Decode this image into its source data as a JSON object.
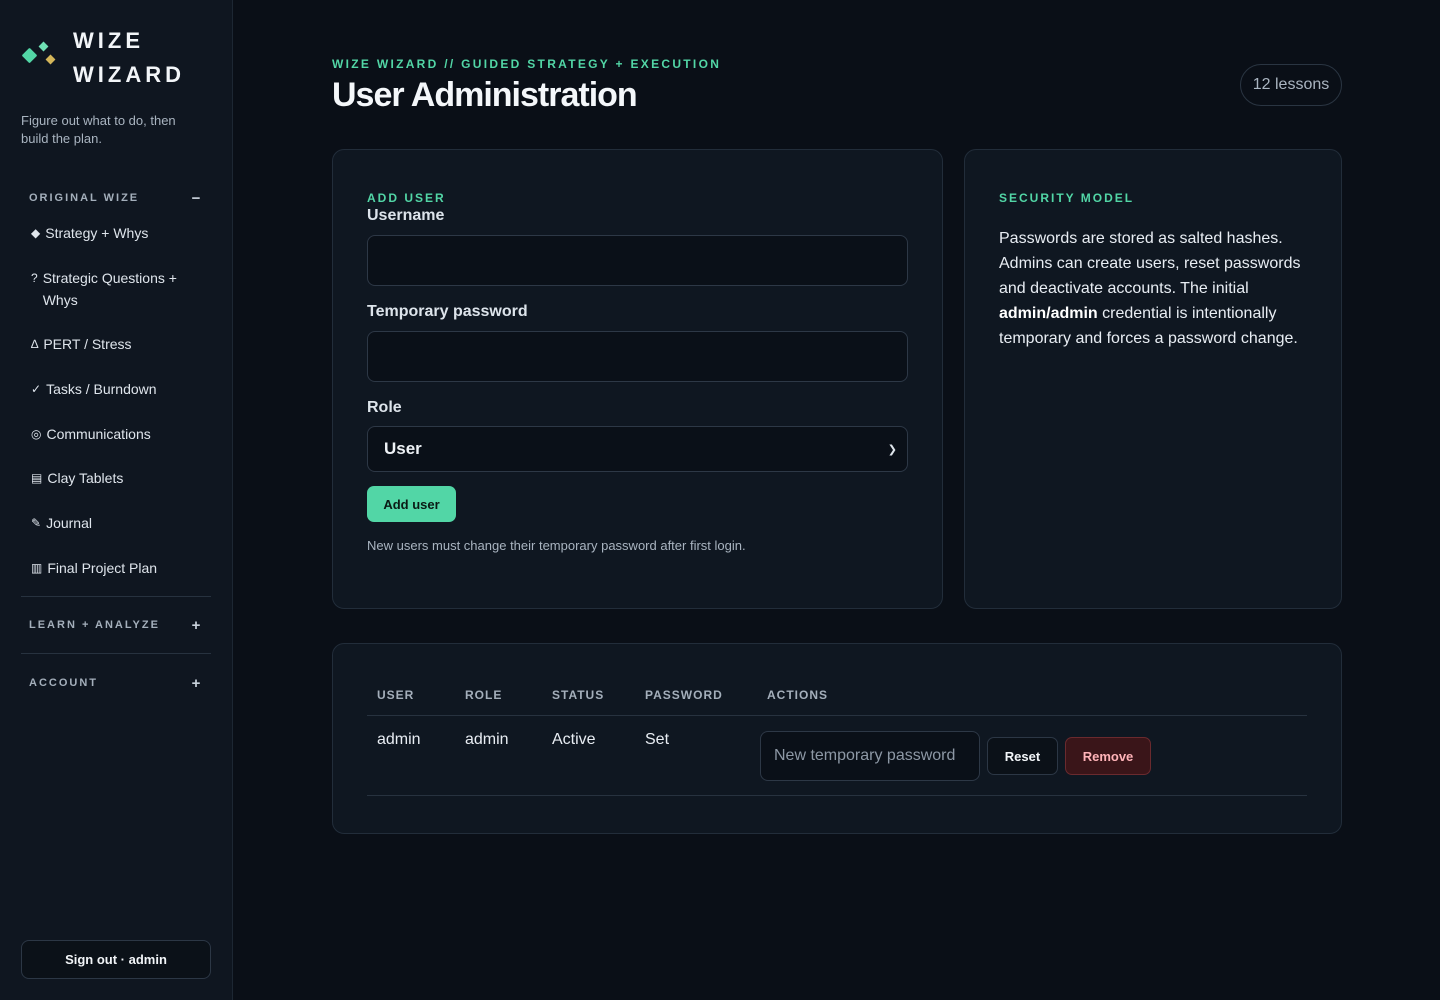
{
  "sidebar": {
    "brand_line1": "WIZE",
    "brand_line2": "WIZARD",
    "tagline": "Figure out what to do, then build the plan.",
    "sections": [
      {
        "label": "ORIGINAL WIZE",
        "toggle": "−",
        "items": [
          {
            "icon": "◆",
            "label": "Strategy + Whys"
          },
          {
            "icon": "?",
            "label": "Strategic Questions + Whys"
          },
          {
            "icon": "∆",
            "label": "PERT / Stress"
          },
          {
            "icon": "✓",
            "label": "Tasks / Burndown"
          },
          {
            "icon": "◎",
            "label": "Communications"
          },
          {
            "icon": "▤",
            "label": "Clay Tablets"
          },
          {
            "icon": "✎",
            "label": "Journal"
          },
          {
            "icon": "▥",
            "label": "Final Project Plan"
          }
        ]
      },
      {
        "label": "LEARN + ANALYZE",
        "toggle": "+"
      },
      {
        "label": "ACCOUNT",
        "toggle": "+"
      }
    ],
    "signout_label": "Sign out · admin"
  },
  "header": {
    "eyebrow": "WIZE WIZARD // GUIDED STRATEGY + EXECUTION",
    "title": "User Administration",
    "lessons_badge": "12 lessons"
  },
  "add_user": {
    "section_label": "ADD USER",
    "username_label": "Username",
    "username_value": "",
    "temp_password_label": "Temporary password",
    "temp_password_value": "",
    "role_label": "Role",
    "role_selected": "User",
    "submit_label": "Add user",
    "hint": "New users must change their temporary password after first login."
  },
  "security": {
    "section_label": "SECURITY MODEL",
    "text_before": "Passwords are stored as salted hashes. Admins can create users, reset passwords and deactivate accounts. The initial ",
    "text_bold": "admin/admin",
    "text_after": " credential is intentionally temporary and forces a password change."
  },
  "users_table": {
    "columns": [
      "USER",
      "ROLE",
      "STATUS",
      "PASSWORD",
      "ACTIONS"
    ],
    "rows": [
      {
        "user": "admin",
        "role": "admin",
        "status": "Active",
        "password": "Set",
        "new_password_placeholder": "New temporary password",
        "reset_label": "Reset",
        "remove_label": "Remove"
      }
    ]
  },
  "colors": {
    "accent": "#52d6a6",
    "background": "#0a0f17",
    "sidebar": "#0f1620",
    "danger_bg": "#3a1519",
    "danger_text": "#ffb3b8"
  }
}
